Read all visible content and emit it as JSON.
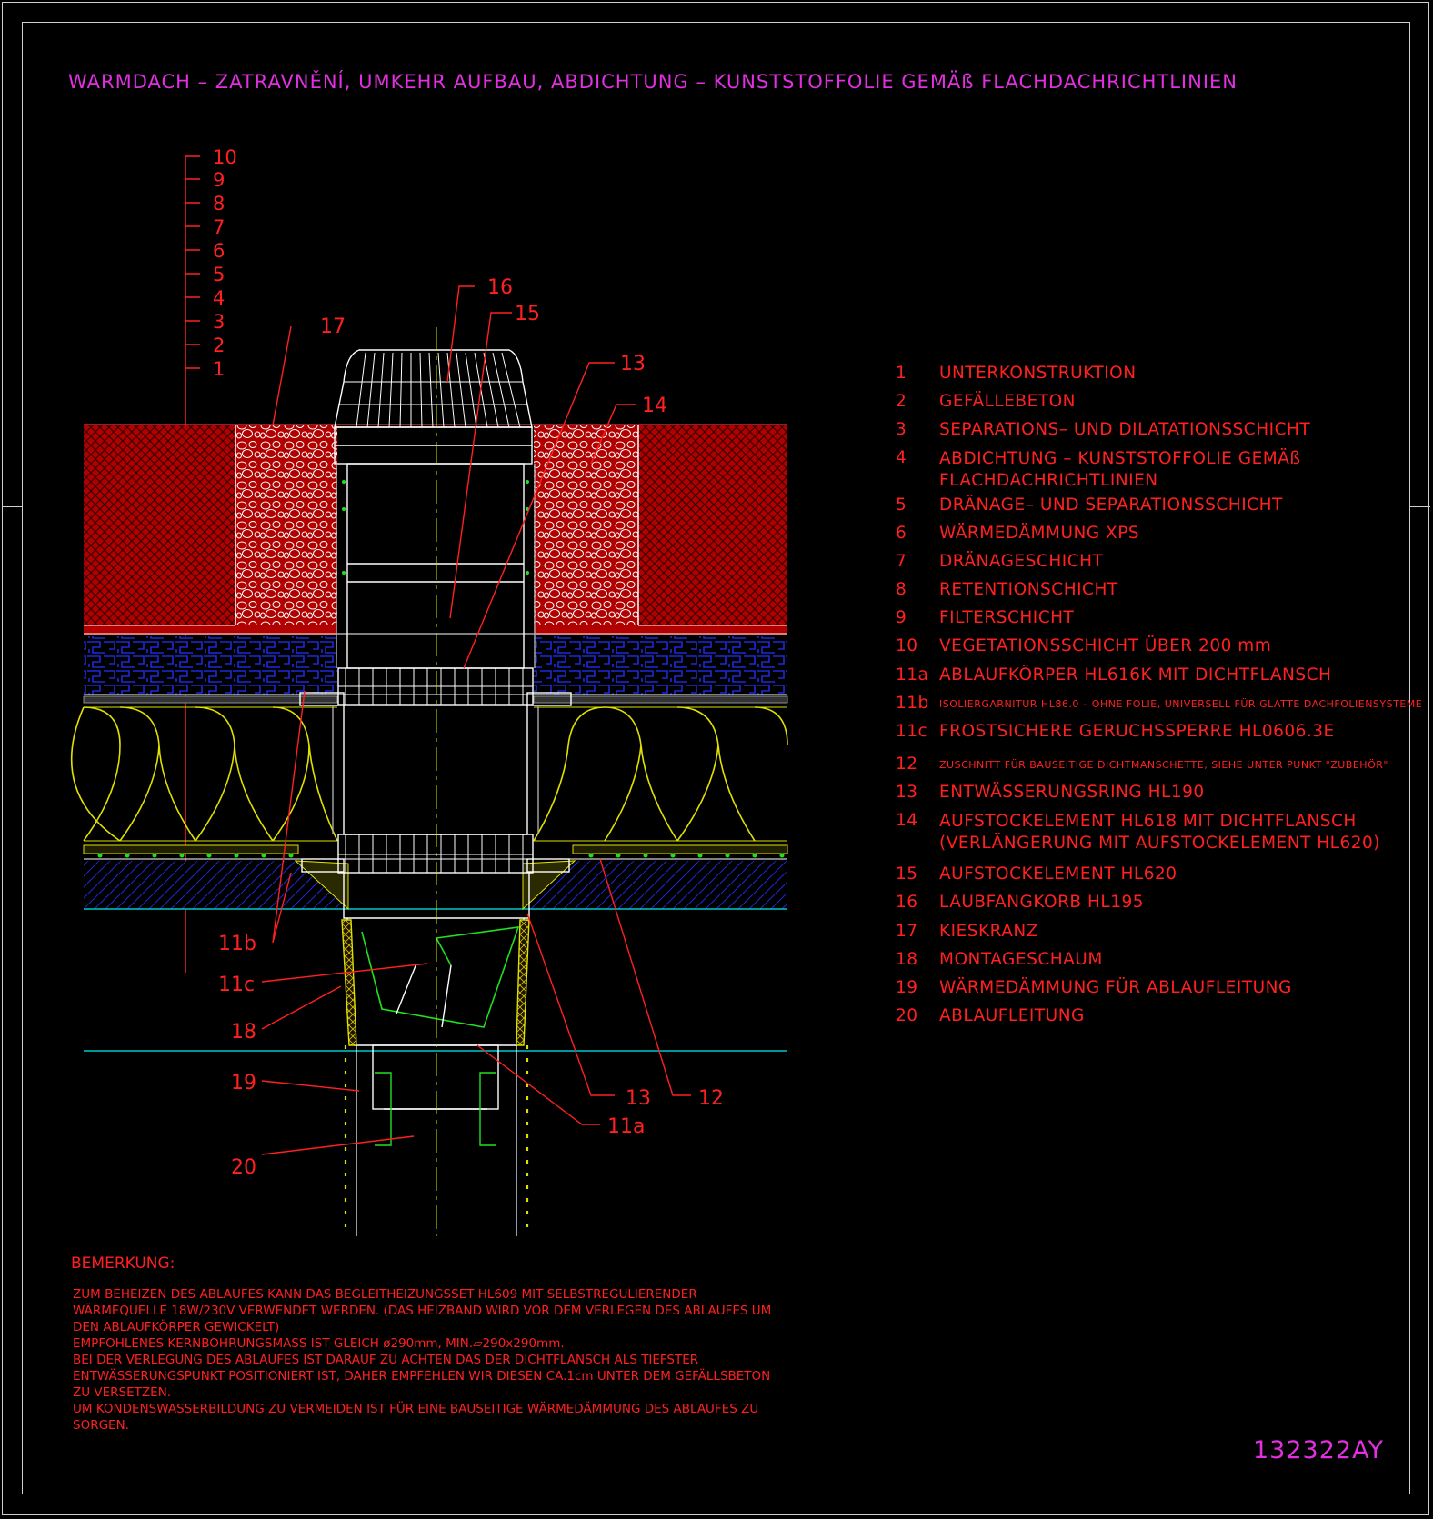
{
  "title": "WARMDACH – ZATRAVNĚNÍ, UMKEHR AUFBAU, ABDICHTUNG – KUNSTSTOFFOLIE GEMÄß FLACHDACHRICHTLINIEN",
  "scale_labels": [
    "10",
    "9",
    "8",
    "7",
    "6",
    "5",
    "4",
    "3",
    "2",
    "1"
  ],
  "callouts": {
    "c16": "16",
    "c15": "15",
    "c17": "17",
    "c13a": "13",
    "c14": "14",
    "c11b": "11b",
    "c11c": "11c",
    "c18": "18",
    "c19": "19",
    "c20": "20",
    "c13b": "13",
    "c12": "12",
    "c11a": "11a"
  },
  "legend": [
    {
      "num": "1",
      "text": "UNTERKONSTRUKTION"
    },
    {
      "num": "2",
      "text": "GEFÄLLEBETON"
    },
    {
      "num": "3",
      "text": "SEPARATIONS– UND DILATATIONSSCHICHT"
    },
    {
      "num": "4",
      "text": "ABDICHTUNG – KUNSTSTOFFOLIE GEMÄß",
      "text2": "FLACHDACHRICHTLINIEN"
    },
    {
      "num": "5",
      "text": "DRÄNAGE– UND SEPARATIONSSCHICHT"
    },
    {
      "num": "6",
      "text": "WÄRMEDÄMMUNG XPS"
    },
    {
      "num": "7",
      "text": "DRÄNAGESCHICHT"
    },
    {
      "num": "8",
      "text": "RETENTIONSCHICHT"
    },
    {
      "num": "9",
      "text": "FILTERSCHICHT"
    },
    {
      "num": "10",
      "text": "VEGETATIONSSCHICHT ÜBER 200 mm"
    },
    {
      "num": "11a",
      "text": "ABLAUFKÖRPER HL616K MIT DICHTFLANSCH"
    },
    {
      "num": "11b",
      "text": "ISOLIERGARNITUR HL86.0 – OHNE FOLIE, UNIVERSELL FÜR GLATTE DACHFOLIENSYSTEME"
    },
    {
      "num": "11c",
      "text": "FROSTSICHERE GERUCHSSPERRE HL0606.3E"
    },
    {
      "num": "12",
      "text": "ZUSCHNITT FÜR BAUSEITIGE DICHTMANSCHETTE, SIEHE UNTER PUNKT \"ZUBEHÖR\""
    },
    {
      "num": "13",
      "text": "ENTWÄSSERUNGSRING HL190"
    },
    {
      "num": "14",
      "text": "AUFSTOCKELEMENT HL618 MIT DICHTFLANSCH",
      "text2": "(VERLÄNGERUNG MIT AUFSTOCKELEMENT HL620)"
    },
    {
      "num": "15",
      "text": "AUFSTOCKELEMENT HL620"
    },
    {
      "num": "16",
      "text": "LAUBFANGKORB HL195"
    },
    {
      "num": "17",
      "text": "KIESKRANZ"
    },
    {
      "num": "18",
      "text": "MONTAGESCHAUM"
    },
    {
      "num": "19",
      "text": "WÄRMEDÄMMUNG FÜR ABLAUFLEITUNG"
    },
    {
      "num": "20",
      "text": "ABLAUFLEITUNG"
    }
  ],
  "remarks": {
    "heading": "BEMERKUNG:",
    "lines": [
      "ZUM BEHEIZEN DES ABLAUFES KANN DAS BEGLEITHEIZUNGSSET HL609 MIT SELBSTREGULIERENDER",
      "WÄRMEQUELLE 18W/230V VERWENDET WERDEN. (DAS HEIZBAND WIRD VOR DEM VERLEGEN DES ABLAUFES UM",
      "DEN ABLAUFKÖRPER GEWICKELT)",
      "EMPFOHLENES KERNBOHRUNGSMASS IST GLEICH ø290mm, MIN.▱290x290mm.",
      "BEI DER VERLEGUNG DES ABLAUFES IST DARAUF ZU ACHTEN DAS DER DICHTFLANSCH ALS TIEFSTER",
      "ENTWÄSSERUNGSPUNKT POSITIONIERT IST, DAHER EMPFEHLEN WIR DIESEN CA.1cm UNTER DEM GEFÄLLSBETON",
      "ZU VERSETZEN.",
      "UM KONDENSWASSERBILDUNG ZU VERMEIDEN IST FÜR EINE BAUSEITIGE WÄRMEDÄMMUNG DES ABLAUFES ZU",
      "SORGEN."
    ]
  },
  "drawing_code": "132322AY",
  "colors": {
    "background": "#000000",
    "frame": "#cfcfcf",
    "title": "#e030e0",
    "annotation": "#ff2020",
    "vegetation": "#b00000",
    "xps_pattern": "#1c2ad6",
    "insulation": "#e0e000",
    "fixing_dots": "#20e020",
    "reference_line": "#00c8c8",
    "drain_body": "#ffffff"
  }
}
